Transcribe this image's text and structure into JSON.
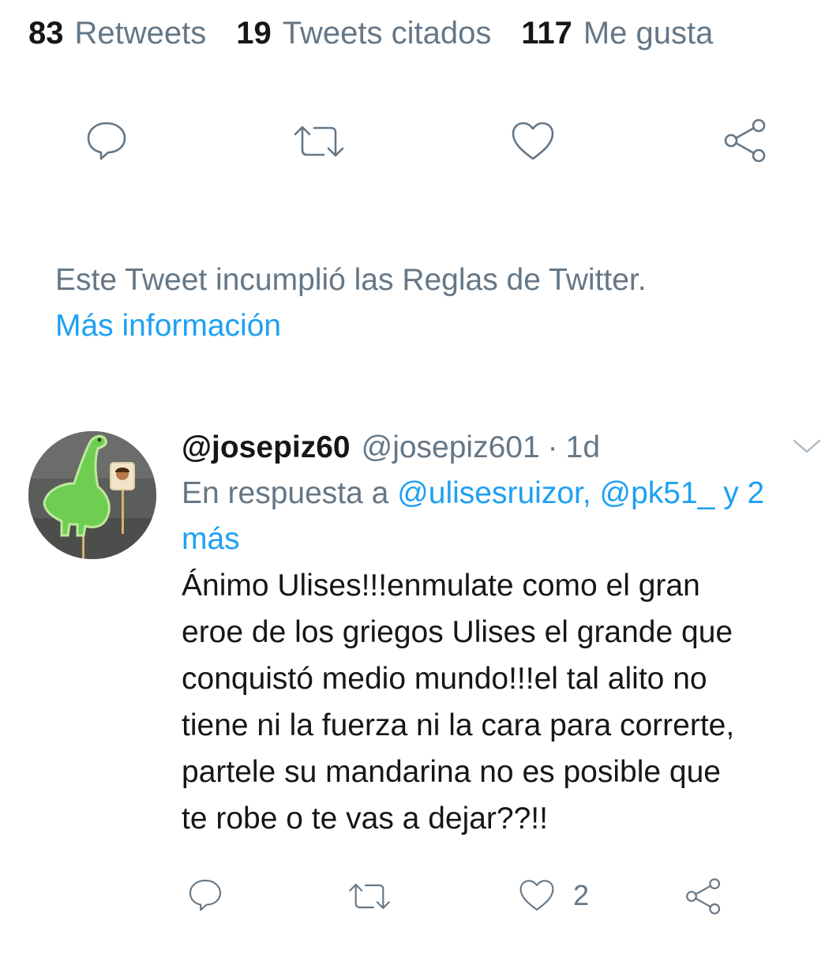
{
  "stats": {
    "retweets_count": "83",
    "retweets_label": "Retweets",
    "quotes_count": "19",
    "quotes_label": "Tweets citados",
    "likes_count": "117",
    "likes_label": "Me gusta"
  },
  "main_actions": {
    "reply_icon": "reply-icon",
    "retweet_icon": "retweet-icon",
    "like_icon": "heart-icon",
    "share_icon": "share-icon"
  },
  "notice": {
    "text": "Este Tweet incumplió las Reglas de Twitter.",
    "link": "Más información"
  },
  "reply": {
    "display_name": "@josepiz60",
    "handle": "@josepiz601",
    "separator": "·",
    "time": "1d",
    "reply_prefix": "En respuesta a",
    "reply_mentions": "@ulisesruizor, @pk51_ y 2 más",
    "text": "Ánimo Ulises!!!enmulate como el gran\neroe de los griegos Ulises el grande que\nconquistó medio mundo!!!el tal alito no\ntiene ni la fuerza ni la cara para correrte,\npartele su mandarina no es posible que\nte robe o te vas a dejar??!!",
    "like_count": "2"
  },
  "colors": {
    "text": "#14171a",
    "secondary": "#657786",
    "accent": "#1da1f2"
  }
}
